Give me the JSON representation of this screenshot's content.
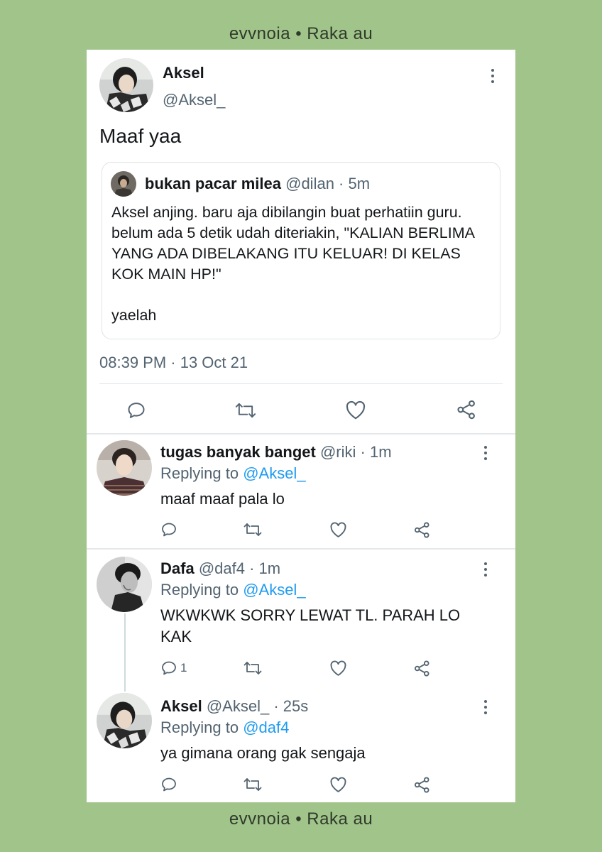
{
  "watermark": {
    "top": "evvnoia • Raka au",
    "bottom": "evvnoia • Raka au"
  },
  "main_tweet": {
    "display_name": "Aksel",
    "handle": "@Aksel_",
    "text": "Maaf yaa",
    "quoted": {
      "display_name": "bukan pacar milea",
      "handle_time": "@dilan · 5m",
      "text": "Aksel anjing. baru aja dibilangin buat perhatiin guru. belum ada 5 detik udah diteriakin, \"KALIAN BERLIMA YANG ADA DIBELAKANG ITU KELUAR! DI KELAS KOK MAIN HP!\"\n\nyaelah"
    },
    "timestamp": "08:39 PM · 13 Oct 21"
  },
  "replies": [
    {
      "display_name": "tugas banyak banget",
      "handle_time": "@riki · 1m",
      "replying_prefix": "Replying to ",
      "replying_to": "@Aksel_",
      "text": "maaf maaf pala lo",
      "reply_count": ""
    },
    {
      "display_name": "Dafa",
      "handle_time": "@daf4 · 1m",
      "replying_prefix": "Replying to ",
      "replying_to": "@Aksel_",
      "text": "WKWKWK SORRY LEWAT TL. PARAH LO KAK",
      "reply_count": "1"
    },
    {
      "display_name": "Aksel",
      "handle_time": "@Aksel_ · 25s",
      "replying_prefix": "Replying to ",
      "replying_to": "@daf4",
      "text": "ya gimana orang gak sengaja",
      "reply_count": ""
    }
  ],
  "icons": [
    "reply-icon",
    "retweet-icon",
    "like-icon",
    "share-icon",
    "more-options-icon"
  ],
  "colors": {
    "background": "#a1c48b",
    "link": "#1d9bf0",
    "muted": "#536471"
  }
}
